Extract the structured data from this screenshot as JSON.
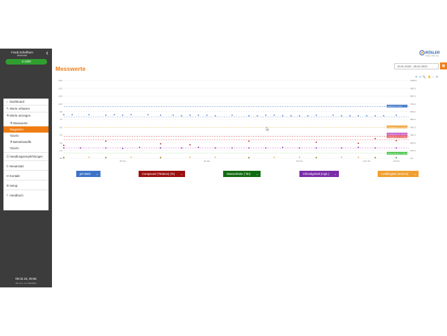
{
  "sidebar": {
    "user_name": "Frank Schellhorn",
    "user_role": "Bearbeiter",
    "device": "Z-1000",
    "items": [
      {
        "label": "Dashboard",
        "icon": "home-icon",
        "glyph": "⌂"
      },
      {
        "label": "Werte erfassen",
        "icon": "edit-icon",
        "glyph": "✎"
      },
      {
        "label": "Werte anzeigen",
        "icon": "flask-icon",
        "glyph": "⚗"
      },
      {
        "label": "Messwerte",
        "icon": "flask-icon",
        "glyph": "⚗"
      },
      {
        "label": "Diagramm",
        "icon": "",
        "glyph": ""
      },
      {
        "label": "Tabelle",
        "icon": "",
        "glyph": ""
      },
      {
        "label": "Betriebsstoffe",
        "icon": "flask-icon",
        "glyph": "⚗"
      },
      {
        "label": "Tabelle",
        "icon": "",
        "glyph": ""
      },
      {
        "label": "Handlungsempfehlungen",
        "icon": "list-icon",
        "glyph": "☰"
      },
      {
        "label": "Neuansatz",
        "icon": "refresh-icon",
        "glyph": "↻"
      },
      {
        "label": "Kontakt",
        "icon": "mail-icon",
        "glyph": "✉"
      },
      {
        "label": "Setup",
        "icon": "gear-icon",
        "glyph": "⚙"
      },
      {
        "label": "Handbuch",
        "icon": "question-icon",
        "glyph": "?"
      }
    ],
    "time": "09.02.23, 09:56",
    "version": "WF 10.1.1.0 c4bb99ba"
  },
  "header": {
    "logo_text": "RÖSLER",
    "logo_tagline": "finding a better way",
    "title": "Messwerte",
    "date_range": "10.01.2023 - 09.02.2023",
    "date_button_icon": "calendar-icon",
    "toolbar_icons": [
      "zoom-in-icon",
      "zoom-out-icon",
      "magnify-icon",
      "pan-icon",
      "home-icon",
      "menu-icon"
    ],
    "toolbar_glyphs": "⊕ ⊖ 🔍 ✋ ⌂ ☰"
  },
  "colors": {
    "accent": "#f07d12",
    "sidebar_bg": "#3c3c3c",
    "device_green": "#2f9e2f",
    "ph": "#3d74c8",
    "compound": "#9c0f0f",
    "water": "#116b11",
    "chloride": "#7a2ca8",
    "conductivity": "#f0a030"
  },
  "legend": [
    {
      "label": "pH-Wert",
      "color": "#3d74c8"
    },
    {
      "label": "Compound (Titration) (%)",
      "color": "#9c0f0f"
    },
    {
      "label": "Wasserhärte (°dH)",
      "color": "#116b11"
    },
    {
      "label": "Chloridgehalt (mg/L)",
      "color": "#7a2ca8"
    },
    {
      "label": "Leitfähigkeit (mS/cm)",
      "color": "#f0a030"
    }
  ],
  "chart_data": {
    "type": "scatter",
    "x_ticks": [
      "15 Jan",
      "22 Jan",
      "29 Jan",
      "Feb '23",
      "12 Feb"
    ],
    "y_left": {
      "ylim": [
        0,
        15
      ],
      "ticks": [
        "0.0",
        "1.5",
        "3.0",
        "4.5",
        "6.0",
        "7.5",
        "9.0",
        "10.5",
        "12.0",
        "13.5",
        "15.0"
      ]
    },
    "y_right": {
      "ylim": [
        0,
        1000
      ],
      "ticks": [
        "0.0",
        "100.0",
        "200.0",
        "300.0",
        "400.0",
        "500.0",
        "600.0",
        "700.0",
        "800.0",
        "900.0",
        "1000.0"
      ]
    },
    "threshold_labels": [
      {
        "text": "pH Max (x.x) - 10 Pol",
        "color": "#3d74c8"
      },
      {
        "text": "Leitfähigkeit (x.x) - 5.2 mS/cm",
        "color": "#f0a030"
      },
      {
        "text": "Chloridgehalt (x.x) - 350.00 mg/L",
        "color": "#c454c4"
      },
      {
        "text": "Leitfähigkeit (x.x) - 3.0 mS/cm",
        "color": "#e85a5a"
      },
      {
        "text": "Chlorwert Min (x.x) - 1.720 °dH",
        "color": "#3fbf3f"
      }
    ],
    "series": [
      {
        "name": "pH-Wert",
        "axis": "left",
        "x": [
          0,
          2,
          6,
          10,
          12,
          14,
          16,
          20,
          23,
          26,
          28,
          30,
          32,
          34,
          36,
          40,
          44,
          46,
          48,
          50,
          52,
          54,
          56,
          58,
          60,
          64,
          66,
          68,
          70,
          72,
          74,
          76,
          79
        ],
        "y": [
          8.4,
          8.4,
          8.4,
          8.3,
          8.4,
          8.3,
          8.4,
          8.4,
          8.3,
          8.3,
          8.2,
          8.3,
          8.3,
          8.3,
          8.2,
          8.3,
          8.2,
          8.2,
          8.3,
          8.3,
          8.2,
          8.2,
          8.2,
          8.2,
          8.3,
          8.3,
          8.2,
          8.2,
          8.2,
          8.2,
          8.2,
          8.2,
          8.3
        ],
        "color": "#3d74c8"
      },
      {
        "name": "Compound (Titration) (%)",
        "axis": "left",
        "x": [
          0,
          10,
          23,
          30,
          44,
          60,
          70,
          74,
          79
        ],
        "y": [
          2.5,
          3.3,
          2.8,
          2.6,
          3.3,
          3.1,
          2.9,
          3.8,
          3.4
        ],
        "color": "#9c0f0f"
      },
      {
        "name": "Wasserhärte (°dH)",
        "axis": "left",
        "x": [
          0,
          10,
          23,
          44,
          60,
          74,
          79
        ],
        "y": [
          0.1,
          0.1,
          0.1,
          0.1,
          0.1,
          0.1,
          0.1
        ],
        "color": "#116b11"
      },
      {
        "name": "Chloridgehalt (mg/L)",
        "axis": "left",
        "x": [
          0,
          4,
          10,
          14,
          18,
          23,
          28,
          32,
          36,
          40,
          44,
          48,
          52,
          56,
          60,
          66,
          70,
          74,
          79
        ],
        "y": [
          2.0,
          2.0,
          2.0,
          1.9,
          2.1,
          2.0,
          2.0,
          2.1,
          2.0,
          2.0,
          2.0,
          2.0,
          2.1,
          2.0,
          2.0,
          2.0,
          2.1,
          2.0,
          2.0
        ],
        "color": "#7a2ca8"
      },
      {
        "name": "Leitfähigkeit (mS/cm)",
        "axis": "left",
        "x": [
          0,
          6,
          10,
          16,
          23,
          30,
          36,
          44,
          50,
          56,
          60,
          66,
          70,
          74
        ],
        "y": [
          0.2,
          0.2,
          0.2,
          0.2,
          0.2,
          0.2,
          0.2,
          0.2,
          0.2,
          0.2,
          0.2,
          0.2,
          0.2,
          0.2
        ],
        "color": "#f0a030"
      }
    ]
  }
}
